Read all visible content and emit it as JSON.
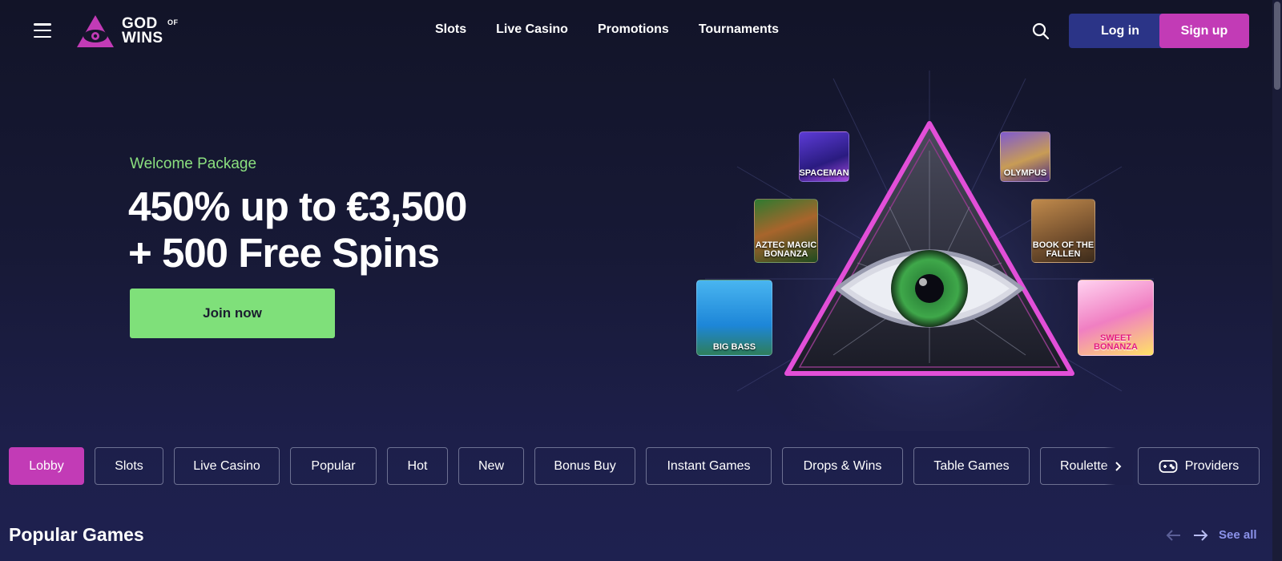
{
  "brand": {
    "logo_line1": "GOD",
    "logo_of": "OF",
    "logo_line2": "WINS",
    "accent_color": "#c23bb6",
    "login_color": "#2b3487",
    "cta_color": "#7fe07a"
  },
  "header": {
    "menu_icon": "hamburger-icon",
    "nav": [
      "Slots",
      "Live Casino",
      "Promotions",
      "Tournaments"
    ],
    "search_icon": "search-icon",
    "login_label": "Log in",
    "signup_label": "Sign up"
  },
  "hero": {
    "kicker": "Welcome Package",
    "title_line1": "450% up to €3,500",
    "title_line2": "+ 500 Free Spins",
    "cta_label": "Join now",
    "games": [
      "SPACEMAN",
      "OLYMPUS",
      "AZTEC MAGIC BONANZA",
      "BOOK OF THE FALLEN",
      "BIG BASS",
      "SWEET BONANZA"
    ]
  },
  "categories": {
    "tabs": [
      "Lobby",
      "Slots",
      "Live Casino",
      "Popular",
      "Hot",
      "New",
      "Bonus Buy",
      "Instant Games",
      "Drops & Wins",
      "Table Games",
      "Roulette"
    ],
    "active": "Lobby",
    "next_icon": "chevron-right-icon",
    "providers_label": "Providers",
    "providers_icon": "gamepad-icon"
  },
  "section": {
    "title": "Popular Games",
    "see_all": "See all",
    "prev_icon": "arrow-left-icon",
    "next_icon": "arrow-right-icon"
  }
}
